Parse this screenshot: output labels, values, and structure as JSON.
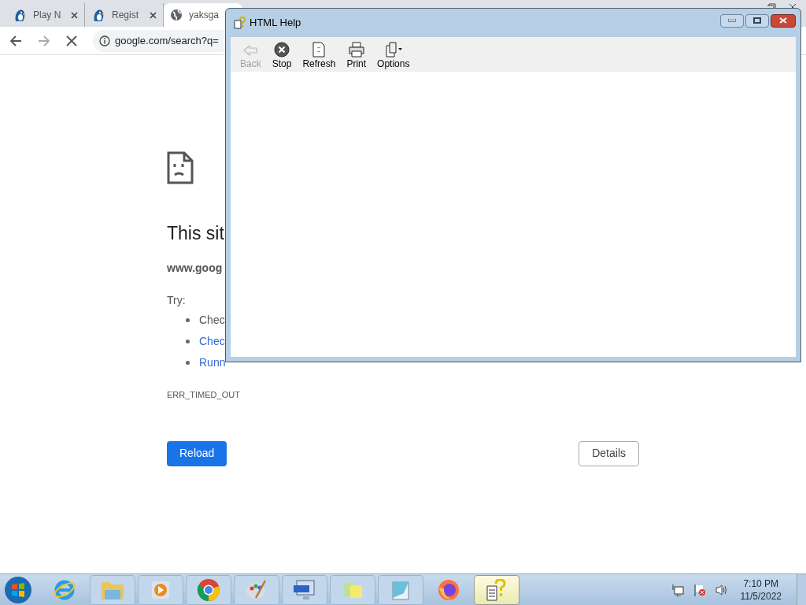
{
  "browser": {
    "tabs": [
      {
        "title": "Play N",
        "kind": "favicon",
        "selected": false
      },
      {
        "title": "Regist",
        "kind": "favicon",
        "selected": false
      },
      {
        "title": "yaksga",
        "kind": "generic",
        "selected": true
      }
    ],
    "address": "google.com/search?q=",
    "error": {
      "heading": "This sit",
      "domain": "www.goog",
      "try_label": "Try:",
      "suggestions": [
        {
          "text": "Chec",
          "kind": "plain"
        },
        {
          "text": "Chec",
          "kind": "link"
        },
        {
          "text": "Runn",
          "kind": "link"
        }
      ],
      "code": "ERR_TIMED_OUT",
      "reload": "Reload",
      "details": "Details"
    }
  },
  "help_window": {
    "title": "HTML Help",
    "toolbar": [
      {
        "label": "Back",
        "kind": "back",
        "disabled": true
      },
      {
        "label": "Stop",
        "kind": "stop",
        "disabled": false
      },
      {
        "label": "Refresh",
        "kind": "refresh",
        "disabled": false
      },
      {
        "label": "Print",
        "kind": "print",
        "disabled": false
      },
      {
        "label": "Options",
        "kind": "options",
        "disabled": false
      }
    ]
  },
  "taskbar": {
    "items": [
      {
        "kind": "ie",
        "selected": false
      },
      {
        "kind": "explorer",
        "selected": false
      },
      {
        "kind": "media",
        "selected": false
      },
      {
        "kind": "chrome",
        "selected": false
      },
      {
        "kind": "paint",
        "selected": false
      },
      {
        "kind": "keyboard",
        "selected": false
      },
      {
        "kind": "notes",
        "selected": false
      },
      {
        "kind": "notepad",
        "selected": false
      },
      {
        "kind": "firefox",
        "selected": false
      },
      {
        "kind": "help",
        "selected": true
      }
    ],
    "time": "7:10 PM",
    "date": "11/5/2022"
  }
}
